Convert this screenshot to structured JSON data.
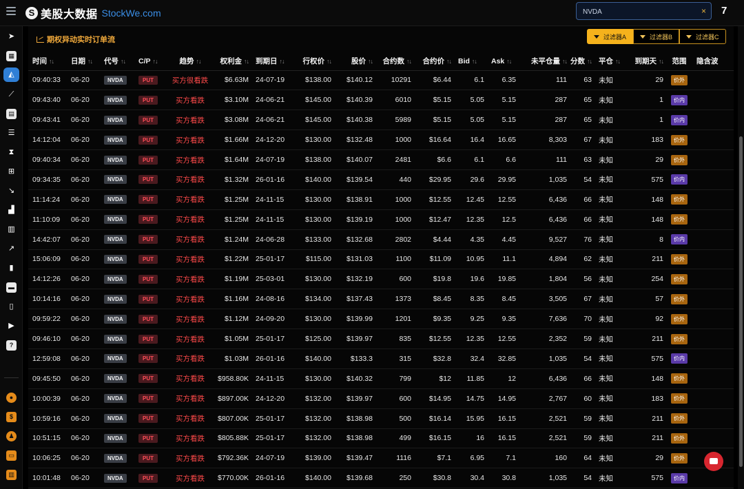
{
  "topbar": {
    "logo_mark": "S",
    "logo_cn": "美股大数据",
    "logo_en": "StockWe.com",
    "search_value": "NVDA",
    "search_clear": "×",
    "count": "7"
  },
  "sidebar": {
    "icons": [
      "rocket-icon",
      "calculator-icon",
      "chart-area-icon",
      "line-chart-icon",
      "calendar-icon",
      "list-icon",
      "hourglass-icon",
      "sitemap-icon",
      "trend-down-icon",
      "industry-icon",
      "bar-chart-icon",
      "line-up-icon",
      "bar-stats-icon",
      "card-icon",
      "book-icon",
      "youtube-icon",
      "help-icon",
      "globe-icon",
      "document-icon",
      "users-icon",
      "wallet-icon",
      "library-icon"
    ]
  },
  "panel": {
    "title": "期权异动实时订单流",
    "filters": [
      "过滤器A",
      "过滤器B",
      "过滤器C"
    ]
  },
  "table": {
    "sort_glyph": "↑↓",
    "columns": [
      "时间",
      "日期",
      "代号",
      "C/P",
      "趋势",
      "权利金",
      "到期日",
      "行权价",
      "股价",
      "合约数",
      "合约价",
      "Bid",
      "Ask",
      "未平仓量",
      "分数",
      "平仓",
      "到期天",
      "范围",
      "隐含波"
    ],
    "rows": [
      [
        "09:40:33",
        "06-20",
        "NVDA",
        "PUT",
        "买方很看跌",
        "$6.63M",
        "24-07-19",
        "$138.00",
        "$140.12",
        "10291",
        "$6.44",
        "6.1",
        "6.35",
        "111",
        "63",
        "未知",
        "29",
        "价外"
      ],
      [
        "09:43:40",
        "06-20",
        "NVDA",
        "PUT",
        "买方看跌",
        "$3.10M",
        "24-06-21",
        "$145.00",
        "$140.39",
        "6010",
        "$5.15",
        "5.05",
        "5.15",
        "287",
        "65",
        "未知",
        "1",
        "价内"
      ],
      [
        "09:43:41",
        "06-20",
        "NVDA",
        "PUT",
        "买方看跌",
        "$3.08M",
        "24-06-21",
        "$145.00",
        "$140.38",
        "5989",
        "$5.15",
        "5.05",
        "5.15",
        "287",
        "65",
        "未知",
        "1",
        "价内"
      ],
      [
        "14:12:04",
        "06-20",
        "NVDA",
        "PUT",
        "买方看跌",
        "$1.66M",
        "24-12-20",
        "$130.00",
        "$132.48",
        "1000",
        "$16.64",
        "16.4",
        "16.65",
        "8,303",
        "67",
        "未知",
        "183",
        "价外"
      ],
      [
        "09:40:34",
        "06-20",
        "NVDA",
        "PUT",
        "买方看跌",
        "$1.64M",
        "24-07-19",
        "$138.00",
        "$140.07",
        "2481",
        "$6.6",
        "6.1",
        "6.6",
        "111",
        "63",
        "未知",
        "29",
        "价外"
      ],
      [
        "09:34:35",
        "06-20",
        "NVDA",
        "PUT",
        "买方看跌",
        "$1.32M",
        "26-01-16",
        "$140.00",
        "$139.54",
        "440",
        "$29.95",
        "29.6",
        "29.95",
        "1,035",
        "54",
        "未知",
        "575",
        "价内"
      ],
      [
        "11:14:24",
        "06-20",
        "NVDA",
        "PUT",
        "买方看跌",
        "$1.25M",
        "24-11-15",
        "$130.00",
        "$138.91",
        "1000",
        "$12.55",
        "12.45",
        "12.55",
        "6,436",
        "66",
        "未知",
        "148",
        "价外"
      ],
      [
        "11:10:09",
        "06-20",
        "NVDA",
        "PUT",
        "买方看跌",
        "$1.25M",
        "24-11-15",
        "$130.00",
        "$139.19",
        "1000",
        "$12.47",
        "12.35",
        "12.5",
        "6,436",
        "66",
        "未知",
        "148",
        "价外"
      ],
      [
        "14:42:07",
        "06-20",
        "NVDA",
        "PUT",
        "买方看跌",
        "$1.24M",
        "24-06-28",
        "$133.00",
        "$132.68",
        "2802",
        "$4.44",
        "4.35",
        "4.45",
        "9,527",
        "76",
        "未知",
        "8",
        "价内"
      ],
      [
        "15:06:09",
        "06-20",
        "NVDA",
        "PUT",
        "买方看跌",
        "$1.22M",
        "25-01-17",
        "$115.00",
        "$131.03",
        "1100",
        "$11.09",
        "10.95",
        "11.1",
        "4,894",
        "62",
        "未知",
        "211",
        "价外"
      ],
      [
        "14:12:26",
        "06-20",
        "NVDA",
        "PUT",
        "买方看跌",
        "$1.19M",
        "25-03-01",
        "$130.00",
        "$132.19",
        "600",
        "$19.8",
        "19.6",
        "19.85",
        "1,804",
        "56",
        "未知",
        "254",
        "价外"
      ],
      [
        "10:14:16",
        "06-20",
        "NVDA",
        "PUT",
        "买方看跌",
        "$1.16M",
        "24-08-16",
        "$134.00",
        "$137.43",
        "1373",
        "$8.45",
        "8.35",
        "8.45",
        "3,505",
        "67",
        "未知",
        "57",
        "价外"
      ],
      [
        "09:59:22",
        "06-20",
        "NVDA",
        "PUT",
        "买方看跌",
        "$1.12M",
        "24-09-20",
        "$130.00",
        "$139.99",
        "1201",
        "$9.35",
        "9.25",
        "9.35",
        "7,636",
        "70",
        "未知",
        "92",
        "价外"
      ],
      [
        "09:46:10",
        "06-20",
        "NVDA",
        "PUT",
        "买方看跌",
        "$1.05M",
        "25-01-17",
        "$125.00",
        "$139.97",
        "835",
        "$12.55",
        "12.35",
        "12.55",
        "2,352",
        "59",
        "未知",
        "211",
        "价外"
      ],
      [
        "12:59:08",
        "06-20",
        "NVDA",
        "PUT",
        "买方看跌",
        "$1.03M",
        "26-01-16",
        "$140.00",
        "$133.3",
        "315",
        "$32.8",
        "32.4",
        "32.85",
        "1,035",
        "54",
        "未知",
        "575",
        "价内"
      ],
      [
        "09:45:50",
        "06-20",
        "NVDA",
        "PUT",
        "买方看跌",
        "$958.80K",
        "24-11-15",
        "$130.00",
        "$140.32",
        "799",
        "$12",
        "11.85",
        "12",
        "6,436",
        "66",
        "未知",
        "148",
        "价外"
      ],
      [
        "10:00:39",
        "06-20",
        "NVDA",
        "PUT",
        "买方看跌",
        "$897.00K",
        "24-12-20",
        "$132.00",
        "$139.97",
        "600",
        "$14.95",
        "14.75",
        "14.95",
        "2,767",
        "60",
        "未知",
        "183",
        "价外"
      ],
      [
        "10:59:16",
        "06-20",
        "NVDA",
        "PUT",
        "买方看跌",
        "$807.00K",
        "25-01-17",
        "$132.00",
        "$138.98",
        "500",
        "$16.14",
        "15.95",
        "16.15",
        "2,521",
        "59",
        "未知",
        "211",
        "价外"
      ],
      [
        "10:51:15",
        "06-20",
        "NVDA",
        "PUT",
        "买方看跌",
        "$805.88K",
        "25-01-17",
        "$132.00",
        "$138.98",
        "499",
        "$16.15",
        "16",
        "16.15",
        "2,521",
        "59",
        "未知",
        "211",
        "价外"
      ],
      [
        "10:06:25",
        "06-20",
        "NVDA",
        "PUT",
        "买方看跌",
        "$792.36K",
        "24-07-19",
        "$139.00",
        "$139.47",
        "1116",
        "$7.1",
        "6.95",
        "7.1",
        "160",
        "64",
        "未知",
        "29",
        "价外"
      ],
      [
        "10:01:48",
        "06-20",
        "NVDA",
        "PUT",
        "买方看跌",
        "$770.00K",
        "26-01-16",
        "$140.00",
        "$139.68",
        "250",
        "$30.8",
        "30.4",
        "30.8",
        "1,035",
        "54",
        "未知",
        "575",
        "价内"
      ]
    ]
  },
  "colors": {
    "accent_orange": "#f0a93b",
    "put_red": "#ff4d57",
    "active_blue": "#2f7fd6"
  }
}
